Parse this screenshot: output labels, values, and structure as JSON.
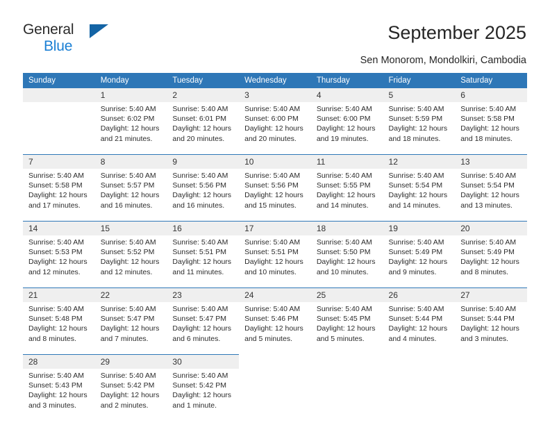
{
  "brand": {
    "name_part1": "General",
    "name_part2": "Blue",
    "triangle_color": "#1464a5",
    "blue_color": "#1a7fd4"
  },
  "header": {
    "title": "September 2025",
    "subtitle": "Sen Monorom, Mondolkiri, Cambodia",
    "accent_color": "#2e77b7",
    "daynum_band_color": "#efefef"
  },
  "calendar": {
    "weekday_headers": [
      "Sunday",
      "Monday",
      "Tuesday",
      "Wednesday",
      "Thursday",
      "Friday",
      "Saturday"
    ],
    "weeks": [
      [
        {
          "day": "",
          "lines": []
        },
        {
          "day": "1",
          "lines": [
            "Sunrise: 5:40 AM",
            "Sunset: 6:02 PM",
            "Daylight: 12 hours",
            "and 21 minutes."
          ]
        },
        {
          "day": "2",
          "lines": [
            "Sunrise: 5:40 AM",
            "Sunset: 6:01 PM",
            "Daylight: 12 hours",
            "and 20 minutes."
          ]
        },
        {
          "day": "3",
          "lines": [
            "Sunrise: 5:40 AM",
            "Sunset: 6:00 PM",
            "Daylight: 12 hours",
            "and 20 minutes."
          ]
        },
        {
          "day": "4",
          "lines": [
            "Sunrise: 5:40 AM",
            "Sunset: 6:00 PM",
            "Daylight: 12 hours",
            "and 19 minutes."
          ]
        },
        {
          "day": "5",
          "lines": [
            "Sunrise: 5:40 AM",
            "Sunset: 5:59 PM",
            "Daylight: 12 hours",
            "and 18 minutes."
          ]
        },
        {
          "day": "6",
          "lines": [
            "Sunrise: 5:40 AM",
            "Sunset: 5:58 PM",
            "Daylight: 12 hours",
            "and 18 minutes."
          ]
        }
      ],
      [
        {
          "day": "7",
          "lines": [
            "Sunrise: 5:40 AM",
            "Sunset: 5:58 PM",
            "Daylight: 12 hours",
            "and 17 minutes."
          ]
        },
        {
          "day": "8",
          "lines": [
            "Sunrise: 5:40 AM",
            "Sunset: 5:57 PM",
            "Daylight: 12 hours",
            "and 16 minutes."
          ]
        },
        {
          "day": "9",
          "lines": [
            "Sunrise: 5:40 AM",
            "Sunset: 5:56 PM",
            "Daylight: 12 hours",
            "and 16 minutes."
          ]
        },
        {
          "day": "10",
          "lines": [
            "Sunrise: 5:40 AM",
            "Sunset: 5:56 PM",
            "Daylight: 12 hours",
            "and 15 minutes."
          ]
        },
        {
          "day": "11",
          "lines": [
            "Sunrise: 5:40 AM",
            "Sunset: 5:55 PM",
            "Daylight: 12 hours",
            "and 14 minutes."
          ]
        },
        {
          "day": "12",
          "lines": [
            "Sunrise: 5:40 AM",
            "Sunset: 5:54 PM",
            "Daylight: 12 hours",
            "and 14 minutes."
          ]
        },
        {
          "day": "13",
          "lines": [
            "Sunrise: 5:40 AM",
            "Sunset: 5:54 PM",
            "Daylight: 12 hours",
            "and 13 minutes."
          ]
        }
      ],
      [
        {
          "day": "14",
          "lines": [
            "Sunrise: 5:40 AM",
            "Sunset: 5:53 PM",
            "Daylight: 12 hours",
            "and 12 minutes."
          ]
        },
        {
          "day": "15",
          "lines": [
            "Sunrise: 5:40 AM",
            "Sunset: 5:52 PM",
            "Daylight: 12 hours",
            "and 12 minutes."
          ]
        },
        {
          "day": "16",
          "lines": [
            "Sunrise: 5:40 AM",
            "Sunset: 5:51 PM",
            "Daylight: 12 hours",
            "and 11 minutes."
          ]
        },
        {
          "day": "17",
          "lines": [
            "Sunrise: 5:40 AM",
            "Sunset: 5:51 PM",
            "Daylight: 12 hours",
            "and 10 minutes."
          ]
        },
        {
          "day": "18",
          "lines": [
            "Sunrise: 5:40 AM",
            "Sunset: 5:50 PM",
            "Daylight: 12 hours",
            "and 10 minutes."
          ]
        },
        {
          "day": "19",
          "lines": [
            "Sunrise: 5:40 AM",
            "Sunset: 5:49 PM",
            "Daylight: 12 hours",
            "and 9 minutes."
          ]
        },
        {
          "day": "20",
          "lines": [
            "Sunrise: 5:40 AM",
            "Sunset: 5:49 PM",
            "Daylight: 12 hours",
            "and 8 minutes."
          ]
        }
      ],
      [
        {
          "day": "21",
          "lines": [
            "Sunrise: 5:40 AM",
            "Sunset: 5:48 PM",
            "Daylight: 12 hours",
            "and 8 minutes."
          ]
        },
        {
          "day": "22",
          "lines": [
            "Sunrise: 5:40 AM",
            "Sunset: 5:47 PM",
            "Daylight: 12 hours",
            "and 7 minutes."
          ]
        },
        {
          "day": "23",
          "lines": [
            "Sunrise: 5:40 AM",
            "Sunset: 5:47 PM",
            "Daylight: 12 hours",
            "and 6 minutes."
          ]
        },
        {
          "day": "24",
          "lines": [
            "Sunrise: 5:40 AM",
            "Sunset: 5:46 PM",
            "Daylight: 12 hours",
            "and 5 minutes."
          ]
        },
        {
          "day": "25",
          "lines": [
            "Sunrise: 5:40 AM",
            "Sunset: 5:45 PM",
            "Daylight: 12 hours",
            "and 5 minutes."
          ]
        },
        {
          "day": "26",
          "lines": [
            "Sunrise: 5:40 AM",
            "Sunset: 5:44 PM",
            "Daylight: 12 hours",
            "and 4 minutes."
          ]
        },
        {
          "day": "27",
          "lines": [
            "Sunrise: 5:40 AM",
            "Sunset: 5:44 PM",
            "Daylight: 12 hours",
            "and 3 minutes."
          ]
        }
      ],
      [
        {
          "day": "28",
          "lines": [
            "Sunrise: 5:40 AM",
            "Sunset: 5:43 PM",
            "Daylight: 12 hours",
            "and 3 minutes."
          ]
        },
        {
          "day": "29",
          "lines": [
            "Sunrise: 5:40 AM",
            "Sunset: 5:42 PM",
            "Daylight: 12 hours",
            "and 2 minutes."
          ]
        },
        {
          "day": "30",
          "lines": [
            "Sunrise: 5:40 AM",
            "Sunset: 5:42 PM",
            "Daylight: 12 hours",
            "and 1 minute."
          ]
        },
        {
          "day": "",
          "lines": []
        },
        {
          "day": "",
          "lines": []
        },
        {
          "day": "",
          "lines": []
        },
        {
          "day": "",
          "lines": []
        }
      ]
    ]
  }
}
